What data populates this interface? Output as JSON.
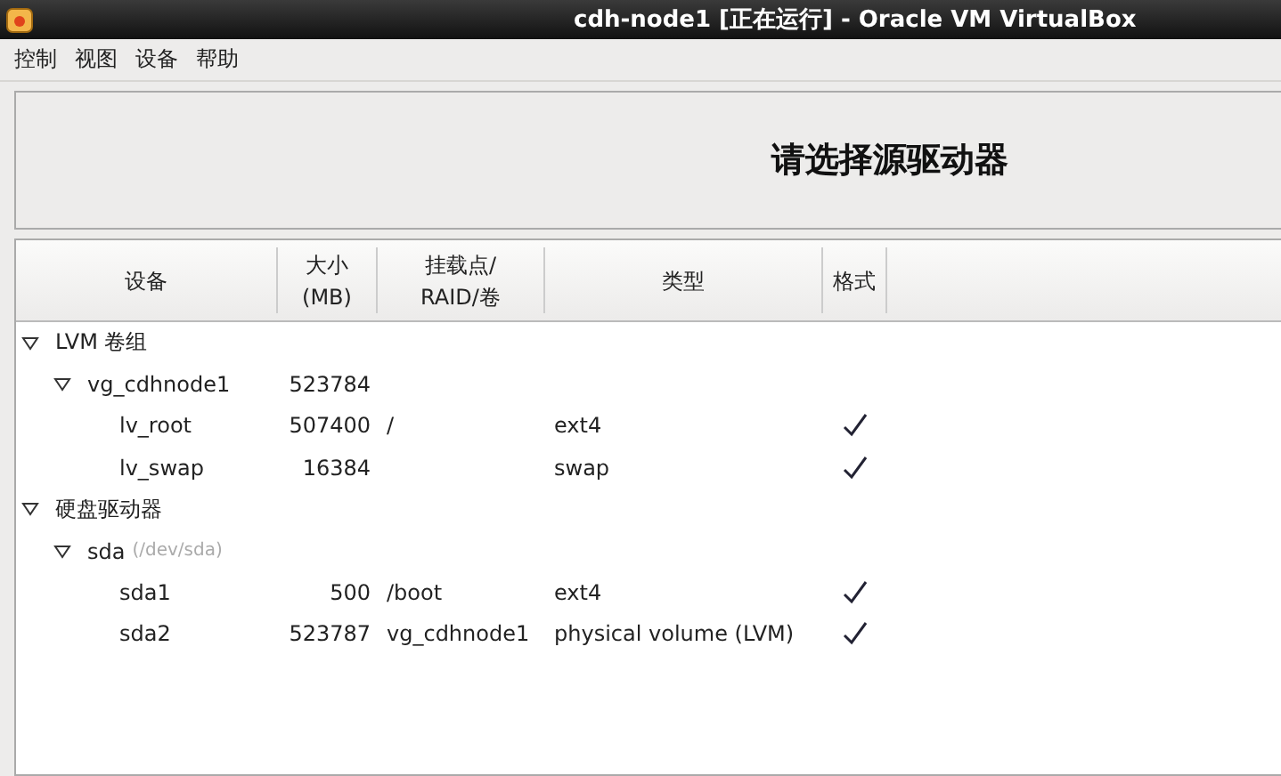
{
  "window": {
    "title": "cdh-node1 [正在运行] - Oracle VM VirtualBox"
  },
  "menu": [
    "控制",
    "视图",
    "设备",
    "帮助"
  ],
  "heading": "请选择源驱动器",
  "table": {
    "columns": [
      "设备",
      "大小\n(MB)",
      "挂载点/\nRAID/卷",
      "类型",
      "格式"
    ],
    "rows": [
      {
        "device": "LVM 卷组",
        "expanded": true,
        "children": [
          {
            "device": "vg_cdhnode1",
            "size": "523784",
            "expanded": true,
            "children": [
              {
                "device": "lv_root",
                "size": "507400",
                "mount": "/",
                "type": "ext4",
                "format": true
              },
              {
                "device": "lv_swap",
                "size": "16384",
                "type": "swap",
                "format": true
              }
            ]
          }
        ]
      },
      {
        "device": "硬盘驱动器",
        "expanded": true,
        "children": [
          {
            "device": "sda",
            "note": "(/dev/sda)",
            "expanded": true,
            "children": [
              {
                "device": "sda1",
                "size": "500",
                "mount": "/boot",
                "type": "ext4",
                "format": true
              },
              {
                "device": "sda2",
                "size": "523787",
                "mount": "vg_cdhnode1",
                "type": "physical volume (LVM)",
                "format": true
              }
            ]
          }
        ]
      }
    ]
  }
}
